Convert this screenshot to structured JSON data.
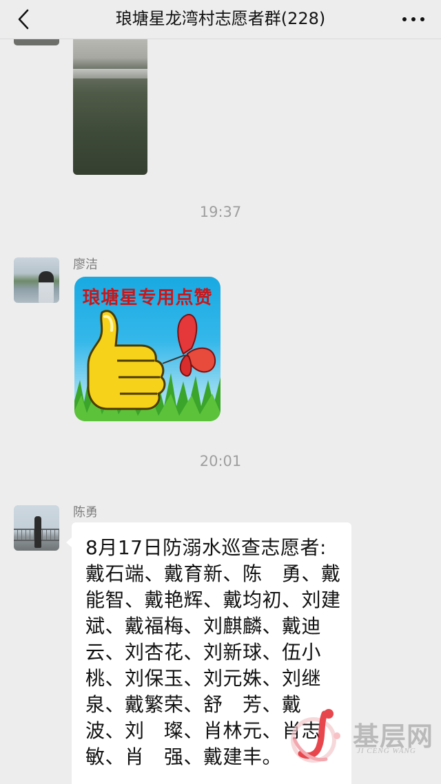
{
  "header": {
    "title": "琅塘星龙湾村志愿者群(228)",
    "back_icon": "chevron-left-icon",
    "more_icon": "more-dots-icon"
  },
  "messages": {
    "timestamp_1": "19:37",
    "timestamp_2": "20:01",
    "msg_liao": {
      "sender": "廖洁",
      "sticker_text": "琅塘星专用点赞"
    },
    "msg_chen": {
      "sender": "陈勇",
      "text": "8月17日防溺水巡查志愿者:\n戴石端、戴育新、陈　勇、戴\n能智、戴艳辉、戴均初、刘建\n斌、戴福梅、刘麒麟、戴迪\n云、刘杏花、刘新球、伍小\n桃、刘保玉、刘元姝、刘继\n泉、戴繁荣、舒　芳、戴\n波、刘　璨、肖林元、肖志\n敏、肖　强、戴建丰。"
    }
  },
  "watermark": {
    "name": "基层网",
    "subtitle": "JI CENG WANG"
  },
  "colors": {
    "background": "#ededed",
    "bubble": "#ffffff",
    "timestamp": "#9e9e9e",
    "sticker_text": "#c8171b"
  }
}
